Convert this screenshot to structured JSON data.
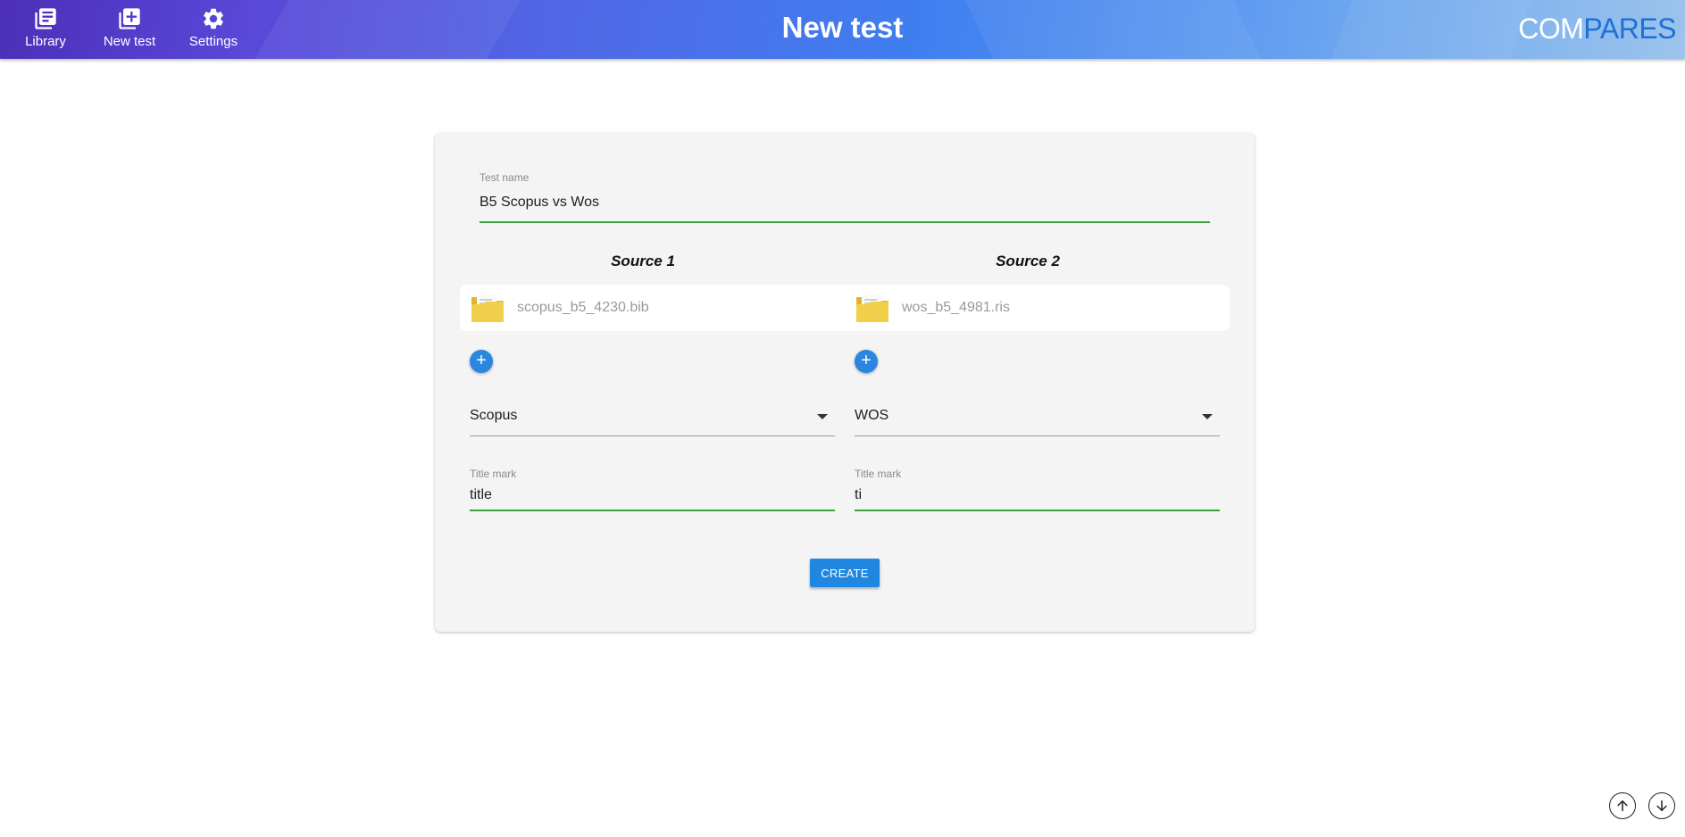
{
  "header": {
    "title": "New test",
    "brand_part1": "COM",
    "brand_part2": "PARES",
    "nav": [
      {
        "label": "Library",
        "icon": "library-icon"
      },
      {
        "label": "New test",
        "icon": "add-box-icon"
      },
      {
        "label": "Settings",
        "icon": "gear-icon"
      }
    ]
  },
  "form": {
    "test_name": {
      "label": "Test name",
      "value": "B5 Scopus vs Wos"
    },
    "sources": [
      {
        "heading": "Source 1",
        "file": "scopus_b5_4230.bib",
        "database": "Scopus",
        "title_mark": {
          "label": "Title mark",
          "value": "title"
        }
      },
      {
        "heading": "Source 2",
        "file": "wos_b5_4981.ris",
        "database": "WOS",
        "title_mark": {
          "label": "Title mark",
          "value": "ti"
        }
      }
    ],
    "create_label": "CREATE"
  },
  "colors": {
    "accent": "#1f87e0",
    "valid_line": "#3aa13a",
    "folder": "#f2cf4a"
  }
}
